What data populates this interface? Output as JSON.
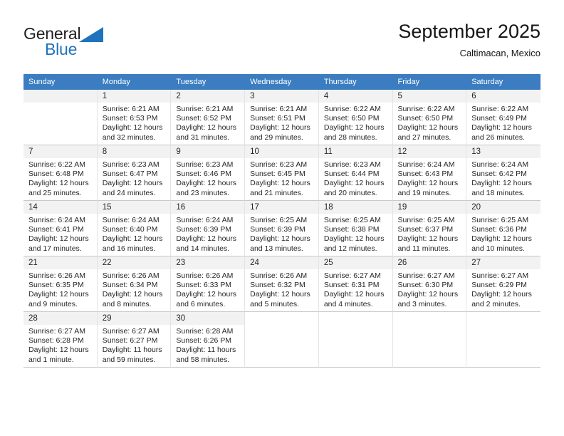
{
  "brand": {
    "word_dark": "General",
    "word_blue": "Blue",
    "triangle_color": "#1f72bd"
  },
  "header": {
    "title": "September 2025",
    "subtitle": "Caltimacan, Mexico"
  },
  "theme": {
    "header_blue": "#3b7dc0",
    "daynum_bg": "#f2f2f2",
    "text": "#262626"
  },
  "labels": {
    "sunrise_prefix": "Sunrise:",
    "sunset_prefix": "Sunset:",
    "daylight_prefix": "Daylight:"
  },
  "weekdays": [
    "Sunday",
    "Monday",
    "Tuesday",
    "Wednesday",
    "Thursday",
    "Friday",
    "Saturday"
  ],
  "weeks": [
    [
      {
        "day": "",
        "blank": true,
        "line1": "",
        "line2": "",
        "line3": "",
        "line4": ""
      },
      {
        "day": "1",
        "line1": "Sunrise: 6:21 AM",
        "line2": "Sunset: 6:53 PM",
        "line3": "Daylight: 12 hours",
        "line4": "and 32 minutes."
      },
      {
        "day": "2",
        "line1": "Sunrise: 6:21 AM",
        "line2": "Sunset: 6:52 PM",
        "line3": "Daylight: 12 hours",
        "line4": "and 31 minutes."
      },
      {
        "day": "3",
        "line1": "Sunrise: 6:21 AM",
        "line2": "Sunset: 6:51 PM",
        "line3": "Daylight: 12 hours",
        "line4": "and 29 minutes."
      },
      {
        "day": "4",
        "line1": "Sunrise: 6:22 AM",
        "line2": "Sunset: 6:50 PM",
        "line3": "Daylight: 12 hours",
        "line4": "and 28 minutes."
      },
      {
        "day": "5",
        "line1": "Sunrise: 6:22 AM",
        "line2": "Sunset: 6:50 PM",
        "line3": "Daylight: 12 hours",
        "line4": "and 27 minutes."
      },
      {
        "day": "6",
        "line1": "Sunrise: 6:22 AM",
        "line2": "Sunset: 6:49 PM",
        "line3": "Daylight: 12 hours",
        "line4": "and 26 minutes."
      }
    ],
    [
      {
        "day": "7",
        "line1": "Sunrise: 6:22 AM",
        "line2": "Sunset: 6:48 PM",
        "line3": "Daylight: 12 hours",
        "line4": "and 25 minutes."
      },
      {
        "day": "8",
        "line1": "Sunrise: 6:23 AM",
        "line2": "Sunset: 6:47 PM",
        "line3": "Daylight: 12 hours",
        "line4": "and 24 minutes."
      },
      {
        "day": "9",
        "line1": "Sunrise: 6:23 AM",
        "line2": "Sunset: 6:46 PM",
        "line3": "Daylight: 12 hours",
        "line4": "and 23 minutes."
      },
      {
        "day": "10",
        "line1": "Sunrise: 6:23 AM",
        "line2": "Sunset: 6:45 PM",
        "line3": "Daylight: 12 hours",
        "line4": "and 21 minutes."
      },
      {
        "day": "11",
        "line1": "Sunrise: 6:23 AM",
        "line2": "Sunset: 6:44 PM",
        "line3": "Daylight: 12 hours",
        "line4": "and 20 minutes."
      },
      {
        "day": "12",
        "line1": "Sunrise: 6:24 AM",
        "line2": "Sunset: 6:43 PM",
        "line3": "Daylight: 12 hours",
        "line4": "and 19 minutes."
      },
      {
        "day": "13",
        "line1": "Sunrise: 6:24 AM",
        "line2": "Sunset: 6:42 PM",
        "line3": "Daylight: 12 hours",
        "line4": "and 18 minutes."
      }
    ],
    [
      {
        "day": "14",
        "line1": "Sunrise: 6:24 AM",
        "line2": "Sunset: 6:41 PM",
        "line3": "Daylight: 12 hours",
        "line4": "and 17 minutes."
      },
      {
        "day": "15",
        "line1": "Sunrise: 6:24 AM",
        "line2": "Sunset: 6:40 PM",
        "line3": "Daylight: 12 hours",
        "line4": "and 16 minutes."
      },
      {
        "day": "16",
        "line1": "Sunrise: 6:24 AM",
        "line2": "Sunset: 6:39 PM",
        "line3": "Daylight: 12 hours",
        "line4": "and 14 minutes."
      },
      {
        "day": "17",
        "line1": "Sunrise: 6:25 AM",
        "line2": "Sunset: 6:39 PM",
        "line3": "Daylight: 12 hours",
        "line4": "and 13 minutes."
      },
      {
        "day": "18",
        "line1": "Sunrise: 6:25 AM",
        "line2": "Sunset: 6:38 PM",
        "line3": "Daylight: 12 hours",
        "line4": "and 12 minutes."
      },
      {
        "day": "19",
        "line1": "Sunrise: 6:25 AM",
        "line2": "Sunset: 6:37 PM",
        "line3": "Daylight: 12 hours",
        "line4": "and 11 minutes."
      },
      {
        "day": "20",
        "line1": "Sunrise: 6:25 AM",
        "line2": "Sunset: 6:36 PM",
        "line3": "Daylight: 12 hours",
        "line4": "and 10 minutes."
      }
    ],
    [
      {
        "day": "21",
        "line1": "Sunrise: 6:26 AM",
        "line2": "Sunset: 6:35 PM",
        "line3": "Daylight: 12 hours",
        "line4": "and 9 minutes."
      },
      {
        "day": "22",
        "line1": "Sunrise: 6:26 AM",
        "line2": "Sunset: 6:34 PM",
        "line3": "Daylight: 12 hours",
        "line4": "and 8 minutes."
      },
      {
        "day": "23",
        "line1": "Sunrise: 6:26 AM",
        "line2": "Sunset: 6:33 PM",
        "line3": "Daylight: 12 hours",
        "line4": "and 6 minutes."
      },
      {
        "day": "24",
        "line1": "Sunrise: 6:26 AM",
        "line2": "Sunset: 6:32 PM",
        "line3": "Daylight: 12 hours",
        "line4": "and 5 minutes."
      },
      {
        "day": "25",
        "line1": "Sunrise: 6:27 AM",
        "line2": "Sunset: 6:31 PM",
        "line3": "Daylight: 12 hours",
        "line4": "and 4 minutes."
      },
      {
        "day": "26",
        "line1": "Sunrise: 6:27 AM",
        "line2": "Sunset: 6:30 PM",
        "line3": "Daylight: 12 hours",
        "line4": "and 3 minutes."
      },
      {
        "day": "27",
        "line1": "Sunrise: 6:27 AM",
        "line2": "Sunset: 6:29 PM",
        "line3": "Daylight: 12 hours",
        "line4": "and 2 minutes."
      }
    ],
    [
      {
        "day": "28",
        "line1": "Sunrise: 6:27 AM",
        "line2": "Sunset: 6:28 PM",
        "line3": "Daylight: 12 hours",
        "line4": "and 1 minute."
      },
      {
        "day": "29",
        "line1": "Sunrise: 6:27 AM",
        "line2": "Sunset: 6:27 PM",
        "line3": "Daylight: 11 hours",
        "line4": "and 59 minutes."
      },
      {
        "day": "30",
        "line1": "Sunrise: 6:28 AM",
        "line2": "Sunset: 6:26 PM",
        "line3": "Daylight: 11 hours",
        "line4": "and 58 minutes."
      },
      {
        "day": "",
        "void": true,
        "line1": "",
        "line2": "",
        "line3": "",
        "line4": ""
      },
      {
        "day": "",
        "void": true,
        "line1": "",
        "line2": "",
        "line3": "",
        "line4": ""
      },
      {
        "day": "",
        "void": true,
        "line1": "",
        "line2": "",
        "line3": "",
        "line4": ""
      },
      {
        "day": "",
        "void": true,
        "line1": "",
        "line2": "",
        "line3": "",
        "line4": ""
      }
    ]
  ]
}
